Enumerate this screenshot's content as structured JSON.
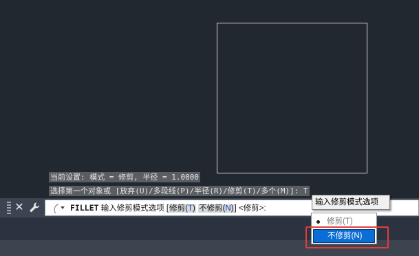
{
  "history": {
    "line1": "当前设置: 模式 = 修剪, 半径 = 1.0000",
    "line2": "选择第一个对象或 [放弃(U)/多段线(P)/半径(R)/修剪(T)/多个(M)]: T"
  },
  "commandline": {
    "close_icon": "✕",
    "command": "FILLET",
    "prompt_text": " 输入修剪模式选项 [",
    "option_trim": "修剪",
    "option_trim_key": "T",
    "option_notrim": "不修剪",
    "option_notrim_key": "N",
    "tail": "] <修剪>:"
  },
  "tooltip": {
    "text": "输入修剪模式选项"
  },
  "menu": {
    "items": [
      {
        "label": "修剪(T)",
        "selected": true
      },
      {
        "label": "不修剪(N)",
        "highlighted": true
      }
    ]
  },
  "colors": {
    "canvas_bg": "#212830",
    "menu_highlight": "#0a6ed6",
    "annotation_box": "#e63b3b"
  }
}
